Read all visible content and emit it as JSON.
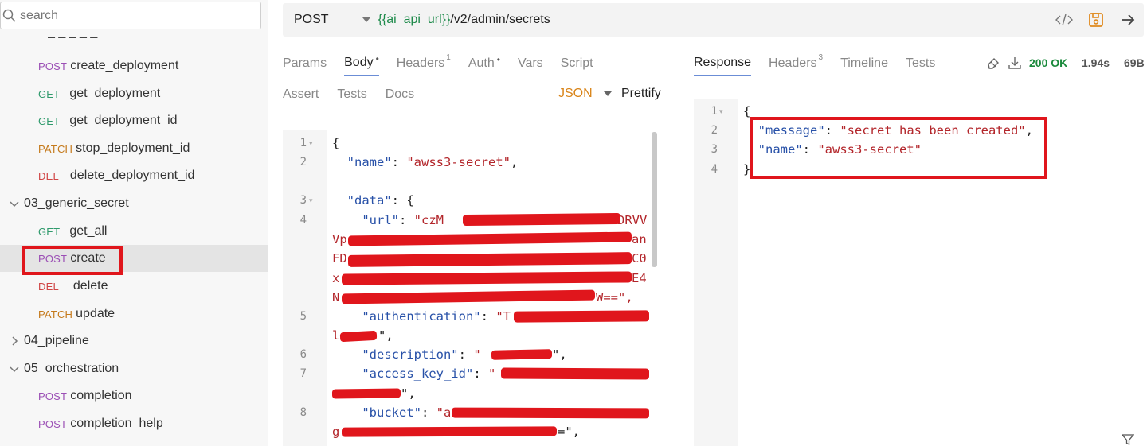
{
  "search": {
    "placeholder": "search"
  },
  "sidebar": {
    "partial_label": "_ _ _ _ _",
    "items": [
      {
        "method": "POST",
        "name": "create_deployment"
      },
      {
        "method": "GET",
        "name": "get_deployment"
      },
      {
        "method": "GET",
        "name": "get_deployment_id"
      },
      {
        "method": "PATCH",
        "name": "stop_deployment_id"
      },
      {
        "method": "DEL",
        "name": "delete_deployment_id"
      },
      {
        "folder": "03_generic_secret"
      },
      {
        "method": "GET",
        "name": "get_all"
      },
      {
        "method": "POST",
        "name": "create"
      },
      {
        "method": "DEL",
        "name": "delete"
      },
      {
        "method": "PATCH",
        "name": "update"
      },
      {
        "folder": "04_pipeline"
      },
      {
        "folder": "05_orchestration"
      },
      {
        "method": "POST",
        "name": "completion"
      },
      {
        "method": "POST",
        "name": "completion_help"
      }
    ]
  },
  "request": {
    "method": "POST",
    "url_var": "{{ai_api_url}}",
    "url_path": "/v2/admin/secrets",
    "tabs_row1": {
      "params": "Params",
      "body": "Body",
      "body_dot": "•",
      "headers": "Headers",
      "headers_count": "1",
      "auth": "Auth",
      "auth_dot": "•",
      "vars": "Vars",
      "script": "Script"
    },
    "tabs_row2": {
      "assert": "Assert",
      "tests": "Tests",
      "docs": "Docs"
    },
    "body_mode": "JSON",
    "prettify": "Prettify",
    "body_lines": {
      "l1": "{",
      "l2_key": "\"name\"",
      "l2_val": "\"awss3-secret\"",
      "l3_key": "\"data\"",
      "l3_rest": ": {",
      "l4_key": "\"url\"",
      "l4_val_a": "\"czM",
      "l4_val_b": "DRVV",
      "l4_w1a": "Vp",
      "l4_w1b": "an",
      "l4_w2a": "FD",
      "l4_w2b": "C0",
      "l4_w3a": "x",
      "l4_w3b": "E4",
      "l4_w4a": "N",
      "l4_w4b": "W==\",",
      "l5_key": "\"authentication\"",
      "l5_val_a": "\"T",
      "l5_w1a": "l",
      "l5_w1b": "\",",
      "l6_key": "\"description\"",
      "l6_val_a": "\"",
      "l6_val_b": "\",",
      "l7_key": "\"access_key_id\"",
      "l7_val_a": "\"",
      "l7_w1b": "\",",
      "l8_key": "\"bucket\"",
      "l8_val_a": "\"a",
      "l8_w1a": "g",
      "l8_w1b": "=\","
    }
  },
  "response": {
    "tabs": {
      "response": "Response",
      "headers": "Headers",
      "headers_count": "3",
      "timeline": "Timeline",
      "tests": "Tests"
    },
    "status": "200 OK",
    "time": "1.94s",
    "size": "69B",
    "lines": {
      "l1": "{",
      "l2_key": "\"message\"",
      "l2_val": "\"secret has been created\"",
      "l3_key": "\"name\"",
      "l3_val": "\"awss3-secret\"",
      "l4": "}"
    }
  },
  "colors": {
    "highlight": "#e0161c",
    "post": "#9b4fb5",
    "get": "#2f9a6c",
    "patch": "#c57a1c",
    "del": "#d04545",
    "url_var": "#1d8a4a",
    "status_ok": "#1a8a3c"
  }
}
